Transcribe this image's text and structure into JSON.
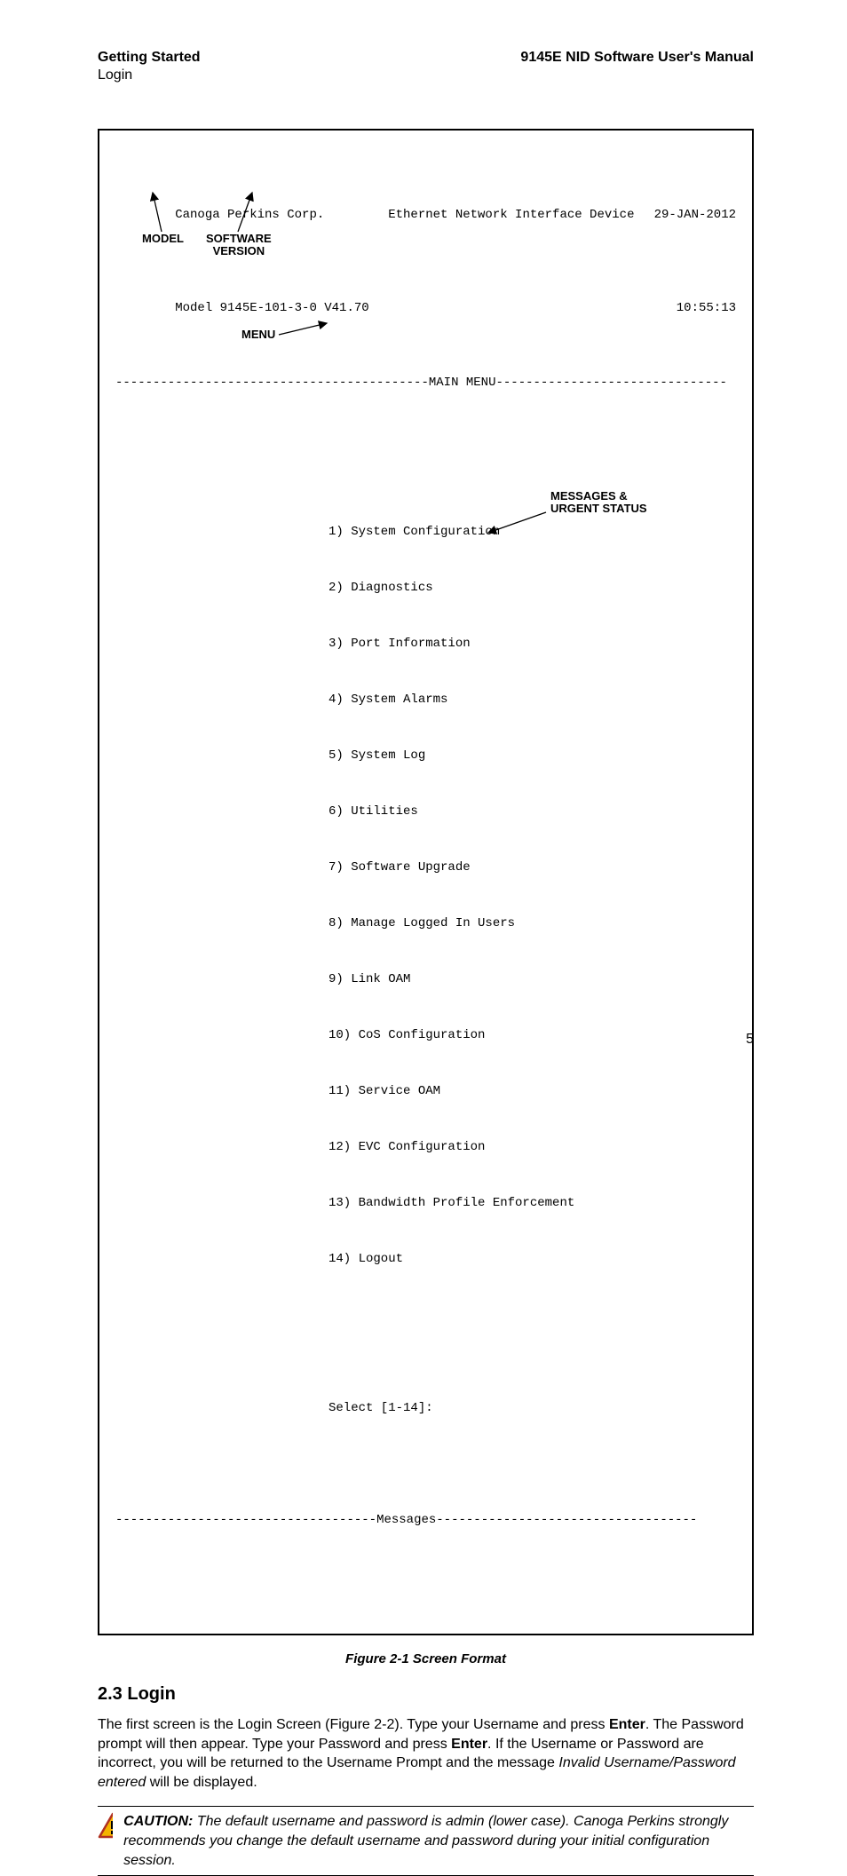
{
  "header": {
    "left_title": "Getting Started",
    "left_sub": "Login",
    "right_title": "9145E NID Software User's Manual"
  },
  "terminal": {
    "company": "Canoga Perkins Corp.",
    "model_line": "Model 9145E-101-3-0 V41.70",
    "device": "Ethernet Network Interface Device",
    "date": "29-JAN-2012",
    "time": "10:55:13",
    "main_menu_label": "MAIN MENU",
    "menu_items": [
      "1) System Configuration",
      "2) Diagnostics",
      "3) Port Information",
      "4) System Alarms",
      "5) System Log",
      "6) Utilities",
      "7) Software Upgrade",
      "8) Manage Logged In Users",
      "9) Link OAM",
      "10) CoS Configuration",
      "11) Service OAM",
      "12) EVC Configuration",
      "13) Bandwidth Profile Enforcement",
      "14) Logout"
    ],
    "prompt": "Select [1-14]:",
    "messages_label": "Messages"
  },
  "callouts": {
    "model": "MODEL",
    "software_version_l1": "SOFTWARE",
    "software_version_l2": "VERSION",
    "menu": "MENU",
    "messages_l1": "MESSAGES &",
    "messages_l2": "URGENT STATUS"
  },
  "figure_caption": "Figure 2-1  Screen Format",
  "section_heading": "2.3  Login",
  "paragraph": {
    "p1": "The first screen is the Login Screen (Figure 2-2). Type your Username and press ",
    "enter1": "Enter",
    "p2": ". The Password prompt will then appear. Type your Password and press ",
    "enter2": "Enter",
    "p3": ". If the Username or Password are incorrect, you will be returned to the Username Prompt and the message ",
    "italic1": "Invalid Username/Password entered",
    "p4": " will be displayed."
  },
  "caution": {
    "label": "CAUTION:",
    "text": " The default username and password is admin (lower case). Canoga Perkins strongly recommends you change the default username and password during your initial configuration session."
  },
  "page_number": "5"
}
